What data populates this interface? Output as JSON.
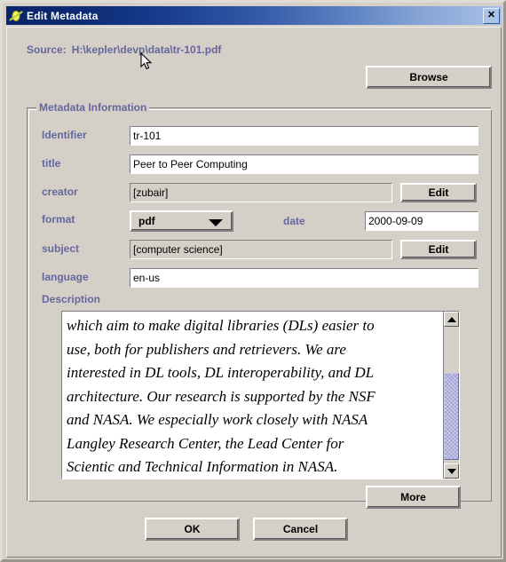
{
  "window": {
    "title": "Edit Metadata",
    "icon": "java-app-icon",
    "close_label": "✕",
    "colors": {
      "face": "#d4d0c8",
      "label_purple": "#66669c",
      "title_blue_dark": "#0a246a",
      "title_blue_light": "#a8c0e6",
      "scrollbar_thumb": "#9d9dd2"
    }
  },
  "source": {
    "label": "Source:",
    "path": "H:\\kepler\\devp\\data\\tr-101.pdf",
    "browse_label": "Browse"
  },
  "group": {
    "title": "Metadata Information",
    "more_label": "More"
  },
  "fields": {
    "identifier": {
      "label": "Identifier",
      "value": "tr-101"
    },
    "title": {
      "label": "title",
      "value": "Peer to Peer Computing"
    },
    "creator": {
      "label": "creator",
      "value": "[zubair]",
      "edit_label": "Edit"
    },
    "format": {
      "label": "format",
      "value": "pdf",
      "options": [
        "pdf"
      ]
    },
    "date": {
      "label": "date",
      "value": "2000-09-09"
    },
    "subject": {
      "label": "subject",
      "value": "[computer science]",
      "edit_label": "Edit"
    },
    "language": {
      "label": "language",
      "value": "en-us"
    }
  },
  "description": {
    "label": "Description",
    "text": "which aim to make digital libraries (DLs) easier to\nuse, both for publishers and retrievers. We are\ninterested in DL tools, DL interoperability, and DL\narchitecture. Our research is supported by the NSF\nand NASA. We especially work closely with NASA\nLangley Research Center, the Lead Center for\nScientic and Technical Information in NASA."
  },
  "footer": {
    "ok_label": "OK",
    "cancel_label": "Cancel"
  }
}
